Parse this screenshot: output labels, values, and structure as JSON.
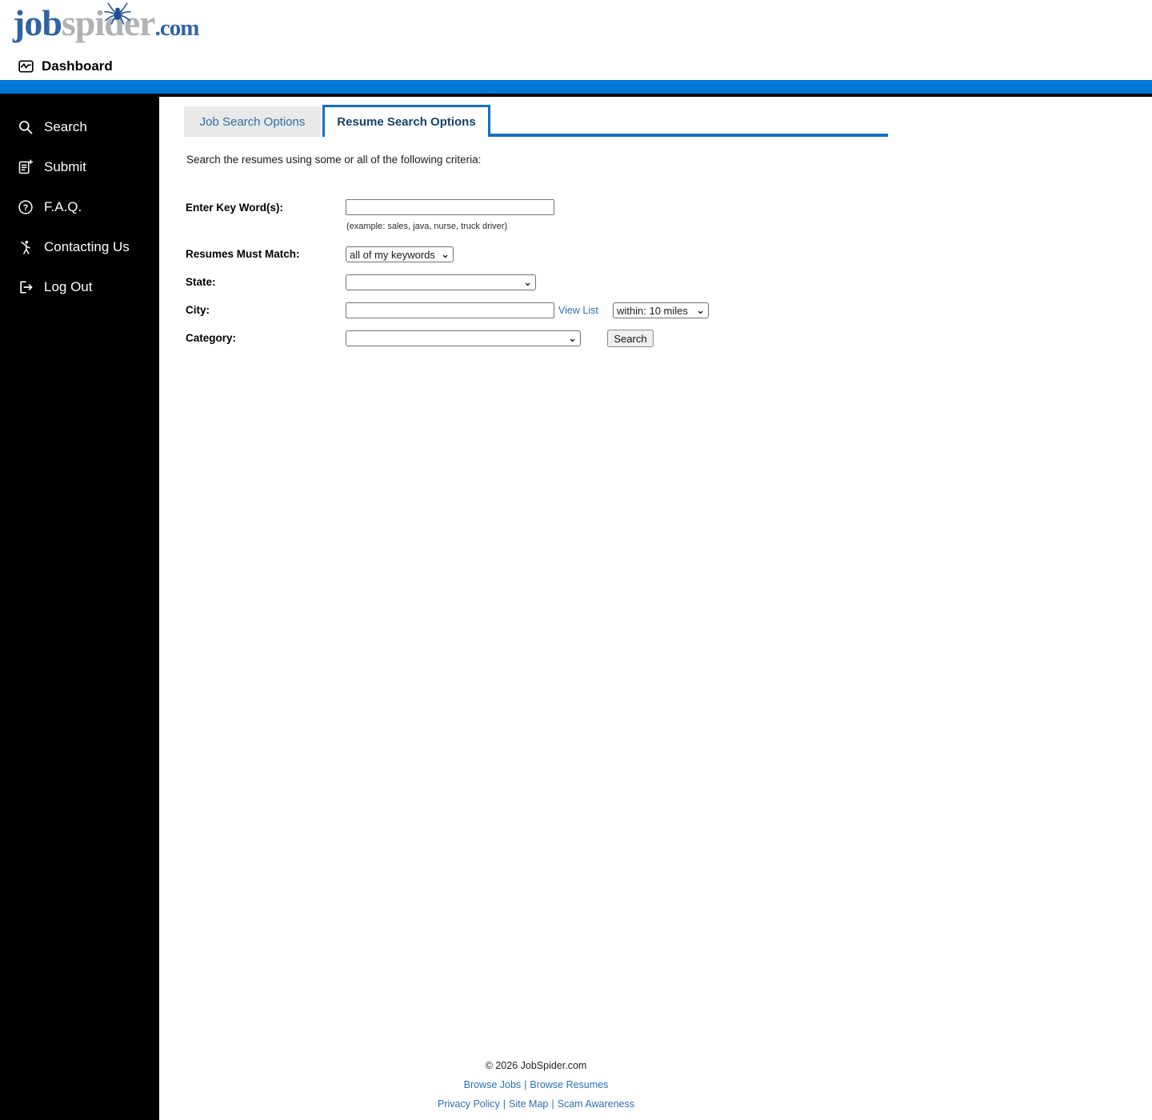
{
  "header": {
    "logo": {
      "job": "job",
      "spider": "spider",
      "dot_com": ".com"
    },
    "dashboard_label": "Dashboard"
  },
  "sidebar": {
    "items": [
      {
        "label": "Search",
        "icon": "search-icon"
      },
      {
        "label": "Submit",
        "icon": "submit-document-icon"
      },
      {
        "label": "F.A.Q.",
        "icon": "question-circle-icon"
      },
      {
        "label": "Contacting Us",
        "icon": "waving-person-icon"
      },
      {
        "label": "Log Out",
        "icon": "logout-arrow-icon"
      }
    ]
  },
  "tabs": {
    "inactive": "Job Search Options",
    "active": "Resume Search Options"
  },
  "form": {
    "intro": "Search the resumes using some or all of the following criteria:",
    "keywords": {
      "label": "Enter Key Word(s):",
      "value": "",
      "hint": "(example: sales, java, nurse, truck driver)"
    },
    "match": {
      "label": "Resumes Must Match:",
      "selected": "all of my keywords"
    },
    "state": {
      "label": "State:",
      "selected": ""
    },
    "city": {
      "label": "City:",
      "value": "",
      "view_list": "View List",
      "radius_selected": "within: 10 miles"
    },
    "category": {
      "label": "Category:",
      "selected": ""
    },
    "search_button": "Search"
  },
  "footer": {
    "copyright": "© 2026 JobSpider.com",
    "separator": "|",
    "links_row1": [
      "Browse Jobs",
      "Browse Resumes"
    ],
    "links_row2": [
      "Privacy Policy",
      "Site Map",
      "Scam Awareness"
    ]
  },
  "icons": {
    "chevron": "⌄",
    "faq_glyph": "?"
  },
  "colors": {
    "top_bar_blue": "#0078d7",
    "tab_blue": "#0f70c8",
    "link_blue": "#2a70b8",
    "logo_blue": "#2f63a7",
    "logo_gray": "#b0b2b5",
    "sidebar_bg": "#000000"
  }
}
